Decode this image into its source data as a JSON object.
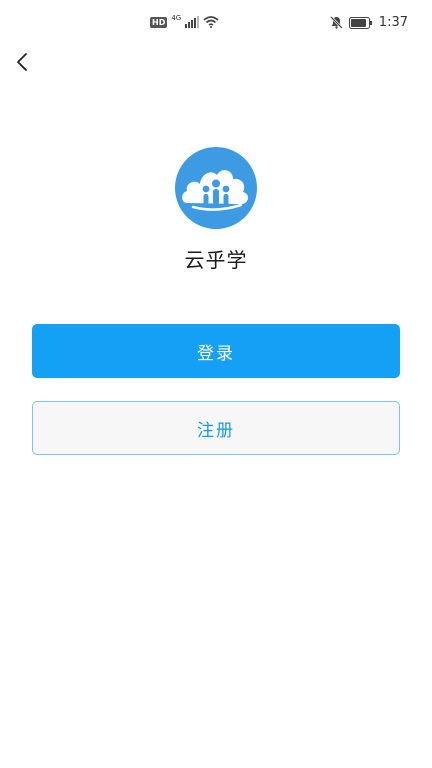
{
  "status_bar": {
    "hd_label": "HD",
    "network_label": "4G",
    "time": "1:37"
  },
  "icons": {
    "back": "chevron-left-icon",
    "logo": "cloud-people-logo",
    "signal": "cellular-signal-icon",
    "wifi": "wifi-icon",
    "mute": "bell-off-icon",
    "battery": "battery-icon"
  },
  "colors": {
    "primary": "#14a1f5",
    "logo_blue": "#3d9be3",
    "register_text": "#149be6",
    "register_border": "#7fc6ec"
  },
  "app": {
    "name": "云乎学"
  },
  "buttons": {
    "login_label": "登录",
    "register_label": "注册"
  }
}
